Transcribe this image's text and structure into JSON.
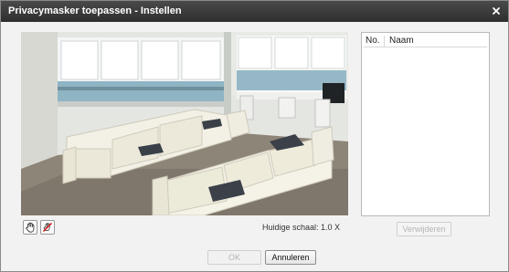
{
  "window": {
    "title": "Privacymasker toepassen - Instellen",
    "close_glyph": "×"
  },
  "video": {
    "description_icon": "camera-preview-image"
  },
  "mask_list": {
    "columns": [
      "No.",
      "Naam"
    ],
    "rows": []
  },
  "tools": {
    "hand_icon": "hand-icon",
    "erase_icon": "erase-mask-icon"
  },
  "status": {
    "scale_text": "Huidige schaal: 1.0 X"
  },
  "buttons": {
    "delete_label": "Verwijderen",
    "ok_label": "OK",
    "cancel_label": "Annuleren"
  },
  "colors": {
    "titlebar": "#333333",
    "dialog_bg": "#f2f2f2",
    "disabled_text": "#b5b5b5"
  }
}
